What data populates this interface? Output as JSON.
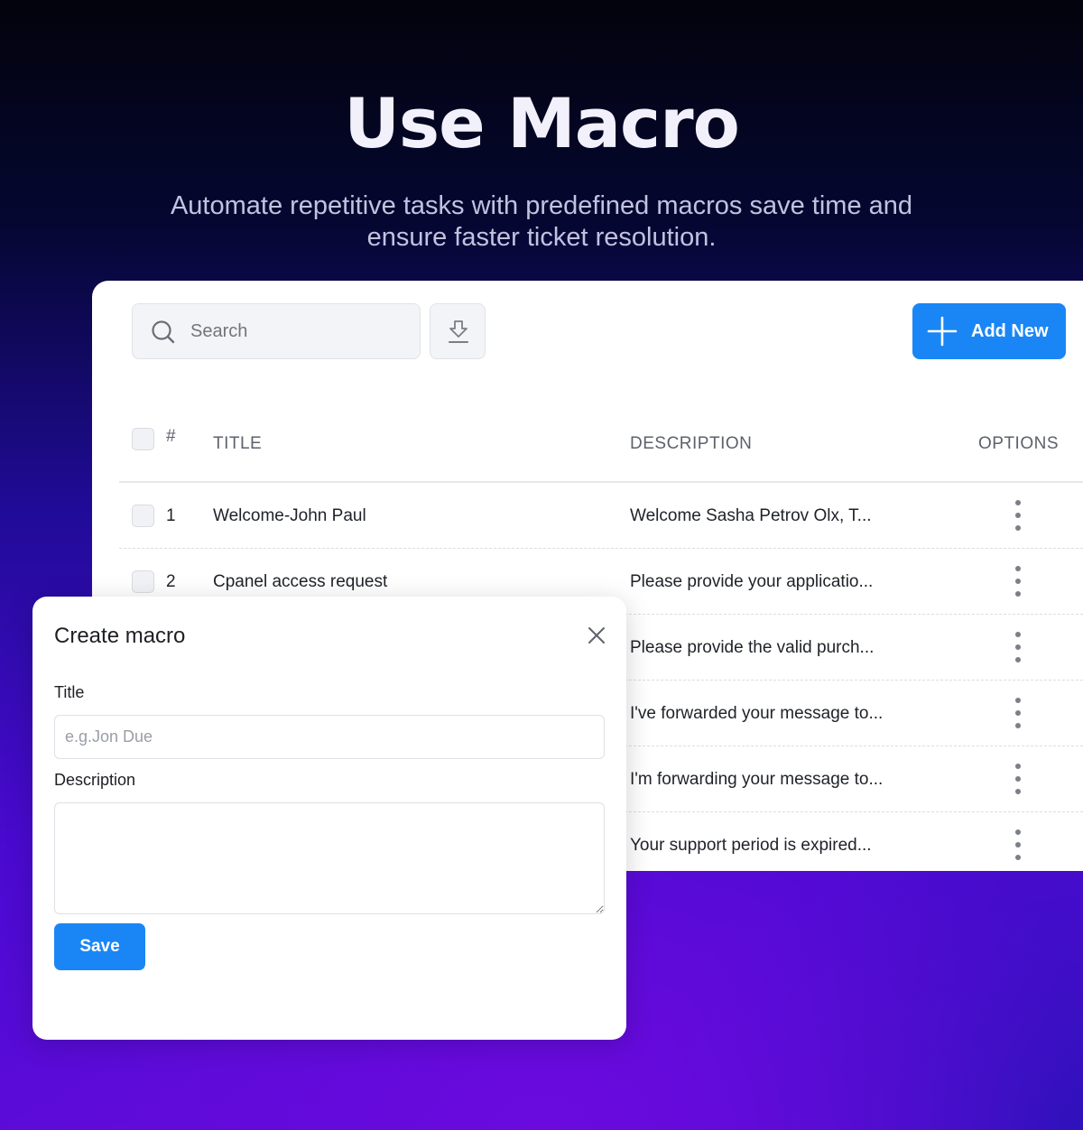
{
  "hero": {
    "title": "Use Macro",
    "subtitle": "Automate repetitive tasks with predefined macros  save time and ensure faster ticket resolution."
  },
  "toolbar": {
    "search_placeholder": "Search",
    "download_icon": "download-icon",
    "add_label": "Add New"
  },
  "table": {
    "columns": {
      "hash": "#",
      "title": "TITLE",
      "description": "DESCRIPTION",
      "options": "OPTIONS"
    },
    "rows": [
      {
        "num": "1",
        "title": "Welcome-John Paul",
        "description": "Welcome Sasha Petrov Olx, T..."
      },
      {
        "num": "2",
        "title": "Cpanel access request",
        "description": "Please provide your applicatio..."
      },
      {
        "num": "",
        "title": "",
        "description": "Please provide the valid purch..."
      },
      {
        "num": "",
        "title": "",
        "description": "I've forwarded your message to..."
      },
      {
        "num": "",
        "title": "",
        "description": "I'm forwarding your message to..."
      },
      {
        "num": "",
        "title": "",
        "description": "Your support period is expired..."
      }
    ]
  },
  "dialog": {
    "title": "Create macro",
    "title_label": "Title",
    "title_placeholder": "e.g.Jon Due",
    "description_label": "Description",
    "save_label": "Save"
  },
  "colors": {
    "accent": "#1a86f5",
    "text": "#1f2229",
    "muted": "#5d616b"
  }
}
